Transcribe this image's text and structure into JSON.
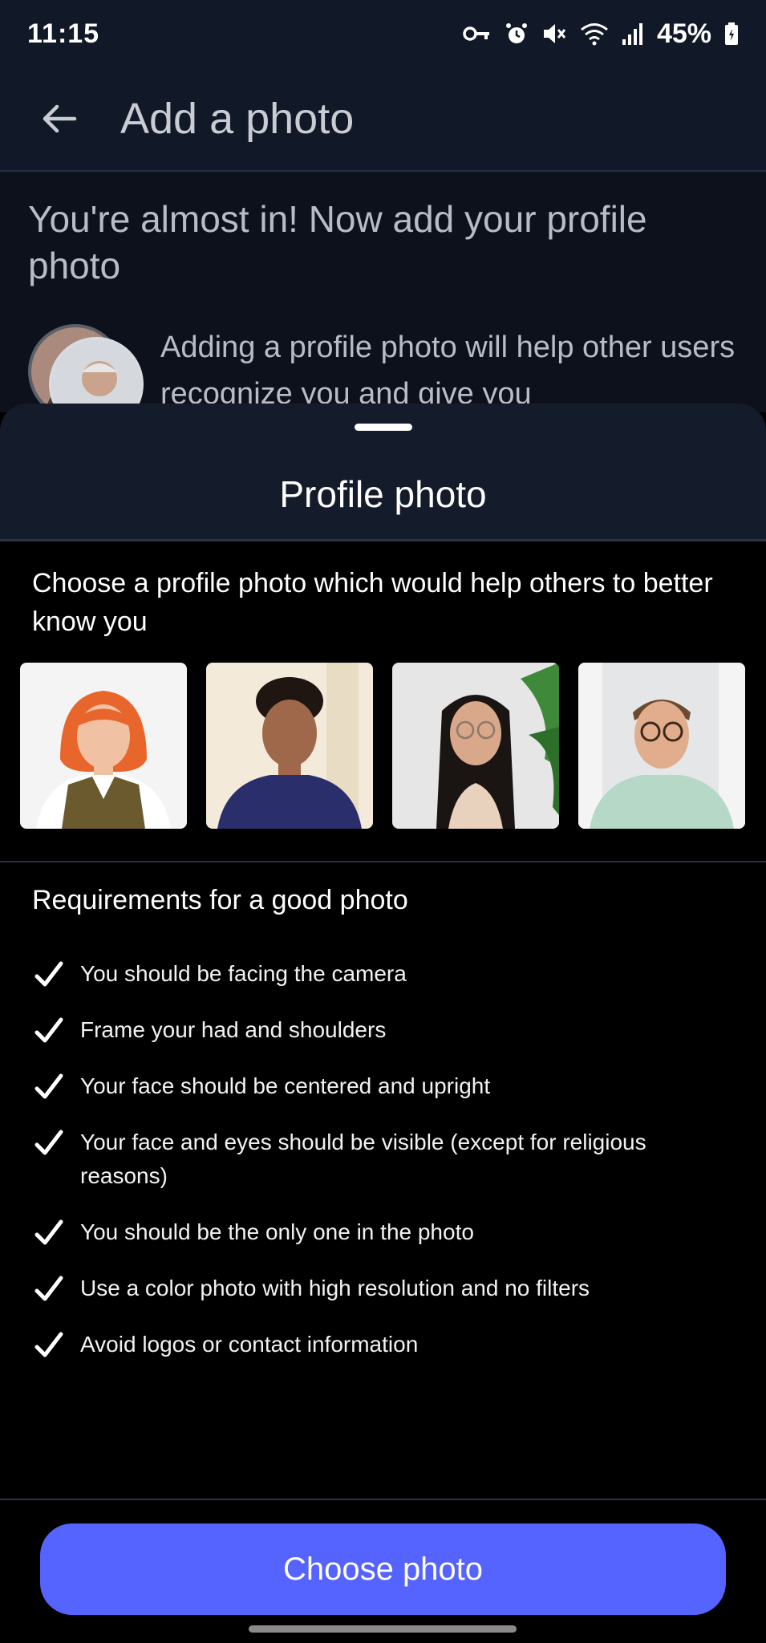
{
  "status_bar": {
    "time": "11:15",
    "battery": "45%",
    "icons": [
      "vpn-key-icon",
      "alarm-icon",
      "mute-icon",
      "wifi-icon",
      "signal-icon",
      "battery-icon"
    ]
  },
  "app_bar": {
    "title": "Add a photo",
    "back_icon": "arrow-left-icon"
  },
  "background": {
    "heading": "You're almost in! Now add your profile photo",
    "description": "Adding a profile photo will help other users recognize you and give you"
  },
  "sheet": {
    "title": "Profile photo",
    "intro": "Choose a profile photo which would help others to better know you",
    "example_photos": [
      {
        "name": "example-photo-woman-orange-hair"
      },
      {
        "name": "example-photo-man-navy-shirt"
      },
      {
        "name": "example-photo-woman-glasses"
      },
      {
        "name": "example-photo-man-glasses"
      }
    ],
    "requirements_title": "Requirements for a good photo",
    "requirements": [
      "You should be facing the camera",
      "Frame your had and shoulders",
      "Your face should be centered and upright",
      "Your face and eyes should be visible (except for religious reasons)",
      "You should be the only one in the photo",
      "Use a color photo with high resolution and no filters",
      "Avoid logos or contact information"
    ],
    "button_label": "Choose photo"
  },
  "colors": {
    "accent": "#5563ff",
    "header_bg": "#111827",
    "sheet_header_bg": "#141b2b",
    "background": "#000000"
  }
}
